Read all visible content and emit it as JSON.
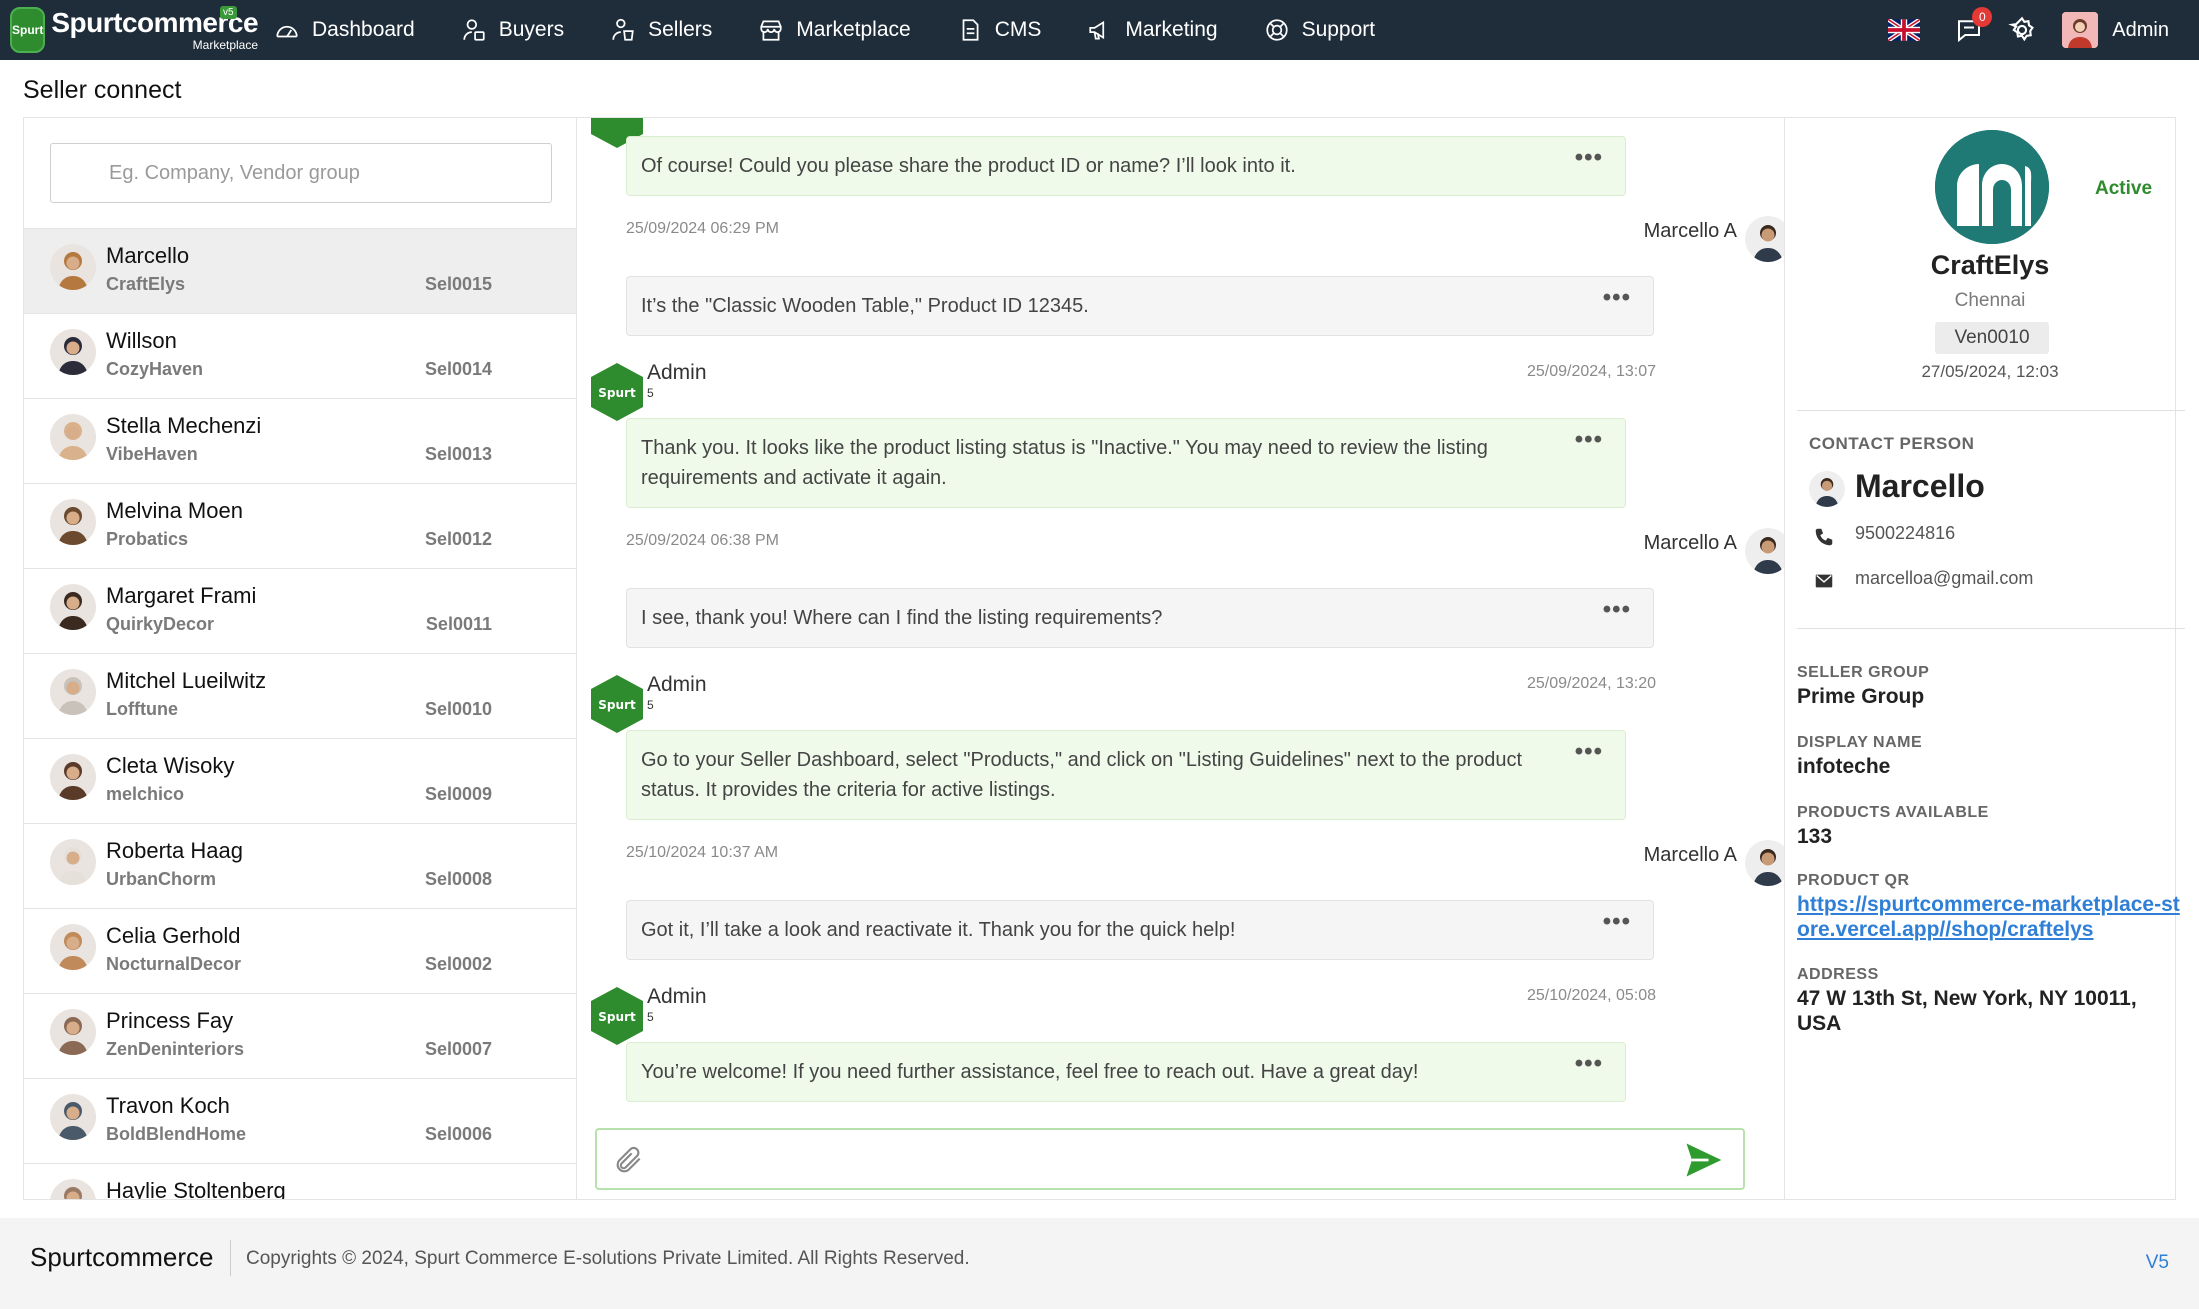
{
  "app": {
    "logo_name": "Spurtcommerce",
    "logo_sub": "Marketplace",
    "logo_version": "v5",
    "logo_mark_text": "Spurt"
  },
  "nav": {
    "items": [
      {
        "label": "Dashboard",
        "icon": "dashboard-icon"
      },
      {
        "label": "Buyers",
        "icon": "buyers-icon"
      },
      {
        "label": "Sellers",
        "icon": "sellers-icon"
      },
      {
        "label": "Marketplace",
        "icon": "marketplace-icon"
      },
      {
        "label": "CMS",
        "icon": "cms-icon"
      },
      {
        "label": "Marketing",
        "icon": "megaphone-icon"
      },
      {
        "label": "Support",
        "icon": "lifebuoy-icon"
      }
    ],
    "notification_count": "0",
    "admin_label": "Admin"
  },
  "page": {
    "title": "Seller connect"
  },
  "search": {
    "placeholder": "Eg. Company, Vendor group"
  },
  "sellers": [
    {
      "name": "Marcello",
      "company": "CraftElys",
      "id": "Sel0015",
      "active": true,
      "color": "#b5793f"
    },
    {
      "name": "Willson",
      "company": "CozyHaven",
      "id": "Sel0014",
      "color": "#2b2b3a"
    },
    {
      "name": "Stella Mechenzi",
      "company": "VibeHaven",
      "id": "Sel0013",
      "color": "#d9b28c"
    },
    {
      "name": "Melvina Moen",
      "company": "Probatics",
      "id": "Sel0012",
      "color": "#6b4a2f"
    },
    {
      "name": "Margaret Frami",
      "company": "QuirkyDecor",
      "id": "Sel0011",
      "color": "#3a2a20"
    },
    {
      "name": "Mitchel Lueilwitz",
      "company": "Lofftune",
      "id": "Sel0010",
      "color": "#c9c2bb"
    },
    {
      "name": "Cleta Wisoky",
      "company": "melchico",
      "id": "Sel0009",
      "color": "#5a3a28"
    },
    {
      "name": "Roberta Haag",
      "company": "UrbanChorm",
      "id": "Sel0008",
      "color": "#e6e0da"
    },
    {
      "name": "Celia Gerhold",
      "company": "NocturnalDecor",
      "id": "Sel0002",
      "color": "#c08a5a"
    },
    {
      "name": "Princess Fay",
      "company": "ZenDeninteriors",
      "id": "Sel0007",
      "color": "#8a6a55"
    },
    {
      "name": "Travon Koch",
      "company": "BoldBlendHome",
      "id": "Sel0006",
      "color": "#4a5a6a"
    },
    {
      "name": "Haylie Stoltenberg",
      "company": "",
      "id": "",
      "color": "#9a7a65"
    }
  ],
  "chat": {
    "admin_name": "Admin",
    "admin_sub": "5",
    "user_name": "Marcello A",
    "messages": [
      {
        "from": "admin",
        "text": "Of course! Could you please share the product ID or name? I’ll look into it.",
        "time": ""
      },
      {
        "from": "user",
        "text": "It’s the \"Classic Wooden Table,\" Product ID 12345.",
        "time": "25/09/2024 06:29 PM"
      },
      {
        "from": "admin",
        "text": "Thank you. It looks like the product listing status is \"Inactive.\" You may need to review the listing requirements and activate it again.",
        "time": "25/09/2024, 13:07"
      },
      {
        "from": "user",
        "text": "I see, thank you! Where can I find the listing requirements?",
        "time": "25/09/2024 06:38 PM"
      },
      {
        "from": "admin",
        "text": "Go to your Seller Dashboard, select \"Products,\" and click on \"Listing Guidelines\" next to the product status. It provides the criteria for active listings.",
        "time": "25/09/2024, 13:20"
      },
      {
        "from": "user",
        "text": "Got it, I’ll take a look and reactivate it. Thank you for the quick help!",
        "time": "25/10/2024 10:37 AM"
      },
      {
        "from": "admin",
        "text": "You’re welcome! If you need further assistance, feel free to reach out. Have a great day!",
        "time": "25/10/2024, 05:08"
      }
    ],
    "menu_glyph": "•••"
  },
  "composer": {
    "placeholder": ""
  },
  "store": {
    "name": "CraftElys",
    "city": "Chennai",
    "vendor_id": "Ven0010",
    "date": "27/05/2024, 12:03",
    "status": "Active"
  },
  "contact": {
    "heading": "CONTACT PERSON",
    "name": "Marcello",
    "phone": "9500224816",
    "email": "marcelloa@gmail.com"
  },
  "fields": {
    "seller_group_label": "SELLER GROUP",
    "seller_group": "Prime Group",
    "display_name_label": "DISPLAY NAME",
    "display_name": "infoteche",
    "products_label": "PRODUCTS AVAILABLE",
    "products": "133",
    "qr_label": "PRODUCT QR",
    "qr_link": "https://spurtcommerce-marketplace-store.vercel.app//shop/craftelys",
    "address_label": "ADDRESS",
    "address": "47 W 13th St, New York, NY 10011, USA"
  },
  "footer": {
    "brand": "Spurtcommerce",
    "copyright": "Copyrights © 2024, Spurt Commerce E-solutions Private Limited. All Rights Reserved.",
    "version": "V5"
  },
  "colors": {
    "nav_bg": "#1f2d3a",
    "accent_green": "#2e8b2e",
    "admin_bubble": "#effaea",
    "link_blue": "#2f7fd6"
  }
}
